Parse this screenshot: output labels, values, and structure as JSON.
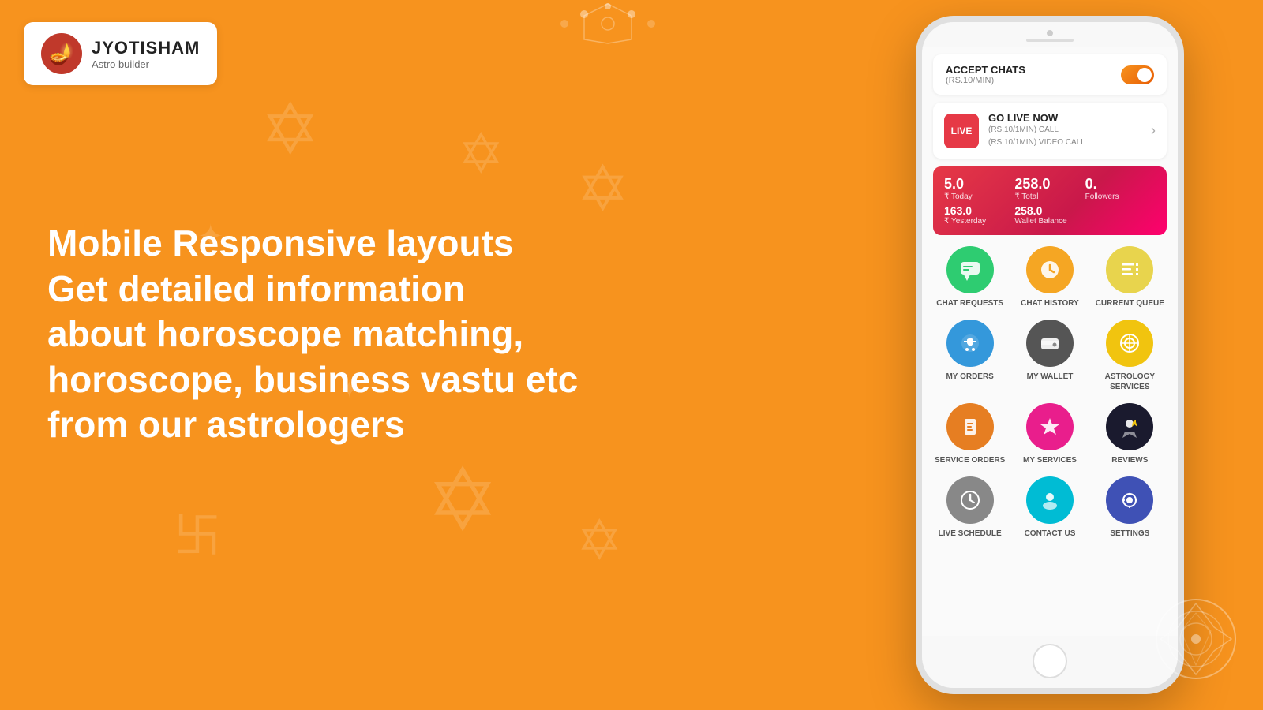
{
  "logo": {
    "icon": "🪔",
    "name": "JYOTISHAM",
    "tagline": "Astro builder"
  },
  "left": {
    "line1": "Mobile Responsive layouts",
    "line2": "Get detailed information",
    "line3": "about horoscope matching,",
    "line4": "horoscope, business vastu etc",
    "line5": "from our astrologers"
  },
  "phone": {
    "accept_chats": {
      "title": "ACCEPT CHATS",
      "subtitle": "(RS.10/MIN)"
    },
    "go_live": {
      "badge": "LIVE",
      "title": "GO LIVE NOW",
      "sub1": "(RS.10/1MIN) CALL",
      "sub2": "(RS.10/1MIN) VIDEO CALL"
    },
    "stats": {
      "today_val": "5.0",
      "today_label": "₹ Today",
      "total_val": "258.0",
      "total_label": "₹ Total",
      "followers_val": "0.",
      "followers_label": "Followers",
      "yesterday_val": "163.0",
      "yesterday_label": "₹ Yesterday",
      "wallet_val": "258.0",
      "wallet_label": "Wallet Balance"
    },
    "menu_items": [
      {
        "id": "chat-requests",
        "label": "CHAT REQUESTS",
        "icon": "💬",
        "bg": "#2ecc71"
      },
      {
        "id": "chat-history",
        "label": "CHAT HISTORY",
        "icon": "🗨️",
        "bg": "#f5a623"
      },
      {
        "id": "current-queue",
        "label": "CURRENT QUEUE",
        "icon": "📋",
        "bg": "#f0e68c"
      },
      {
        "id": "my-orders",
        "label": "MY ORDERS",
        "icon": "🛒",
        "bg": "#3498db"
      },
      {
        "id": "my-wallet",
        "label": "MY WALLET",
        "icon": "👛",
        "bg": "#555"
      },
      {
        "id": "astrology-services",
        "label": "ASTROLOGY SERVICES",
        "icon": "⚙️",
        "bg": "#f1c40f"
      },
      {
        "id": "service-orders",
        "label": "SERVICE ORDERS",
        "icon": "📦",
        "bg": "#e67e22"
      },
      {
        "id": "my-services",
        "label": "MY SERVICES",
        "icon": "✨",
        "bg": "#e91e8c"
      },
      {
        "id": "reviews",
        "label": "REVIEWS",
        "icon": "⭐",
        "bg": "#1a1a2e"
      },
      {
        "id": "live-schedule",
        "label": "LIVE SCHEDULE",
        "icon": "🕐",
        "bg": "#888"
      },
      {
        "id": "contact-us",
        "label": "CONTACT US",
        "icon": "👤",
        "bg": "#00bcd4"
      },
      {
        "id": "settings",
        "label": "SETTINGS",
        "icon": "⚙️",
        "bg": "#3f51b5"
      }
    ]
  },
  "colors": {
    "bg_orange": "#F7931E",
    "accent_red": "#e63946",
    "green": "#2ecc71",
    "yellow": "#f1c40f",
    "blue": "#3498db",
    "dark": "#1a1a2e",
    "teal": "#00bcd4"
  }
}
